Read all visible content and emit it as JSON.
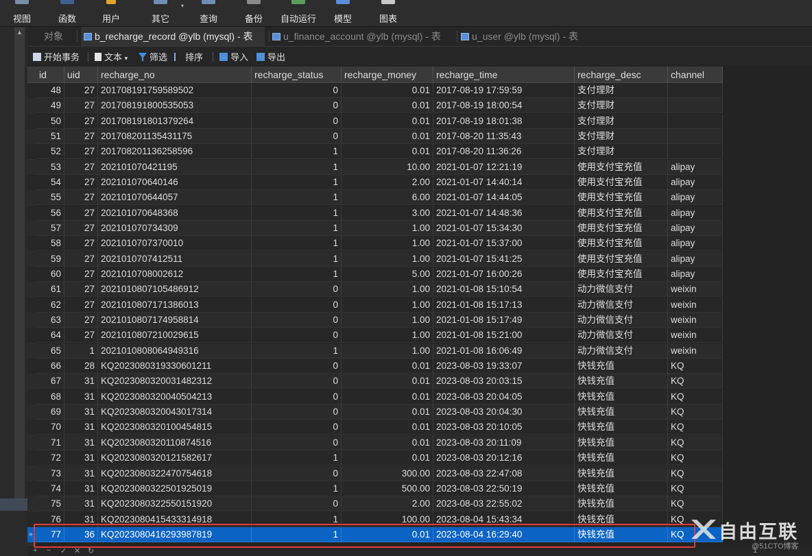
{
  "ribbon": {
    "items": [
      {
        "label": "视图",
        "icon": "view-icon"
      },
      {
        "label": "函数",
        "icon": "function-icon"
      },
      {
        "label": "用户",
        "icon": "user-icon"
      },
      {
        "label": "其它",
        "icon": "other-icon"
      },
      {
        "label": "查询",
        "icon": "query-icon"
      },
      {
        "label": "备份",
        "icon": "backup-icon"
      },
      {
        "label": "自动运行",
        "icon": "autorun-icon"
      },
      {
        "label": "模型",
        "icon": "model-icon"
      },
      {
        "label": "图表",
        "icon": "chart-icon"
      }
    ],
    "other_caret": "▾"
  },
  "tabs": [
    {
      "label": "对象",
      "active": false,
      "icon": ""
    },
    {
      "label": "b_recharge_record @ylb (mysql) - 表",
      "active": true,
      "icon": "table-icon"
    },
    {
      "label": "u_finance_account @ylb (mysql) - 表",
      "active": false,
      "icon": "table-icon"
    },
    {
      "label": "u_user @ylb (mysql) - 表",
      "active": false,
      "icon": "table-icon"
    }
  ],
  "toolbar": {
    "begin_transaction": "开始事务",
    "text": "文本",
    "text_caret": "▾",
    "filter": "筛选",
    "sort": "排序",
    "import": "导入",
    "export": "导出"
  },
  "grid": {
    "columns": [
      "id",
      "uid",
      "recharge_no",
      "recharge_status",
      "recharge_money",
      "recharge_time",
      "recharge_desc",
      "channel"
    ],
    "rows": [
      [
        "48",
        "27",
        "201708191759589502",
        "0",
        "0.01",
        "2017-08-19 17:59:59",
        "支付理财",
        ""
      ],
      [
        "49",
        "27",
        "201708191800535053",
        "0",
        "0.01",
        "2017-08-19 18:00:54",
        "支付理财",
        ""
      ],
      [
        "50",
        "27",
        "201708191801379264",
        "0",
        "0.01",
        "2017-08-19 18:01:38",
        "支付理财",
        ""
      ],
      [
        "51",
        "27",
        "201708201135431175",
        "0",
        "0.01",
        "2017-08-20 11:35:43",
        "支付理财",
        ""
      ],
      [
        "52",
        "27",
        "201708201136258596",
        "1",
        "0.01",
        "2017-08-20 11:36:26",
        "支付理财",
        ""
      ],
      [
        "53",
        "27",
        "202101070421195",
        "1",
        "10.00",
        "2021-01-07 12:21:19",
        "使用支付宝充值",
        "alipay"
      ],
      [
        "54",
        "27",
        "202101070640146",
        "1",
        "2.00",
        "2021-01-07 14:40:14",
        "使用支付宝充值",
        "alipay"
      ],
      [
        "55",
        "27",
        "202101070644057",
        "1",
        "6.00",
        "2021-01-07 14:44:05",
        "使用支付宝充值",
        "alipay"
      ],
      [
        "56",
        "27",
        "202101070648368",
        "1",
        "3.00",
        "2021-01-07 14:48:36",
        "使用支付宝充值",
        "alipay"
      ],
      [
        "57",
        "27",
        "202101070734309",
        "1",
        "1.00",
        "2021-01-07 15:34:30",
        "使用支付宝充值",
        "alipay"
      ],
      [
        "58",
        "27",
        "2021010707370010",
        "1",
        "1.00",
        "2021-01-07 15:37:00",
        "使用支付宝充值",
        "alipay"
      ],
      [
        "59",
        "27",
        "2021010707412511",
        "1",
        "1.00",
        "2021-01-07 15:41:25",
        "使用支付宝充值",
        "alipay"
      ],
      [
        "60",
        "27",
        "2021010708002612",
        "1",
        "5.00",
        "2021-01-07 16:00:26",
        "使用支付宝充值",
        "alipay"
      ],
      [
        "61",
        "27",
        "2021010807105486912",
        "0",
        "1.00",
        "2021-01-08 15:10:54",
        "动力微信支付",
        "weixin"
      ],
      [
        "62",
        "27",
        "2021010807171386013",
        "0",
        "1.00",
        "2021-01-08 15:17:13",
        "动力微信支付",
        "weixin"
      ],
      [
        "63",
        "27",
        "2021010807174958814",
        "0",
        "1.00",
        "2021-01-08 15:17:49",
        "动力微信支付",
        "weixin"
      ],
      [
        "64",
        "27",
        "2021010807210029615",
        "0",
        "1.00",
        "2021-01-08 15:21:00",
        "动力微信支付",
        "weixin"
      ],
      [
        "65",
        "1",
        "2021010808064949316",
        "1",
        "1.00",
        "2021-01-08 16:06:49",
        "动力微信支付",
        "weixin"
      ],
      [
        "66",
        "28",
        "KQ2023080319330601211",
        "0",
        "0.01",
        "2023-08-03 19:33:07",
        "快钱充值",
        "KQ"
      ],
      [
        "67",
        "31",
        "KQ2023080320031482312",
        "0",
        "0.01",
        "2023-08-03 20:03:15",
        "快钱充值",
        "KQ"
      ],
      [
        "68",
        "31",
        "KQ2023080320040504213",
        "0",
        "0.01",
        "2023-08-03 20:04:05",
        "快钱充值",
        "KQ"
      ],
      [
        "69",
        "31",
        "KQ2023080320043017314",
        "0",
        "0.01",
        "2023-08-03 20:04:30",
        "快钱充值",
        "KQ"
      ],
      [
        "70",
        "31",
        "KQ2023080320100454815",
        "0",
        "0.01",
        "2023-08-03 20:10:05",
        "快钱充值",
        "KQ"
      ],
      [
        "71",
        "31",
        "KQ2023080320110874516",
        "0",
        "0.01",
        "2023-08-03 20:11:09",
        "快钱充值",
        "KQ"
      ],
      [
        "72",
        "31",
        "KQ2023080320121582617",
        "1",
        "0.01",
        "2023-08-03 20:12:16",
        "快钱充值",
        "KQ"
      ],
      [
        "73",
        "31",
        "KQ2023080322470754618",
        "0",
        "300.00",
        "2023-08-03 22:47:08",
        "快钱充值",
        "KQ"
      ],
      [
        "74",
        "31",
        "KQ2023080322501925019",
        "1",
        "500.00",
        "2023-08-03 22:50:19",
        "快钱充值",
        "KQ"
      ],
      [
        "75",
        "31",
        "KQ2023080322550151920",
        "0",
        "2.00",
        "2023-08-03 22:55:02",
        "快钱充值",
        "KQ"
      ],
      [
        "76",
        "31",
        "KQ2023080415433314918",
        "1",
        "100.00",
        "2023-08-04 15:43:34",
        "快钱充值",
        "KQ"
      ],
      [
        "77",
        "36",
        "KQ2023080416293987819",
        "1",
        "0.01",
        "2023-08-04 16:29:40",
        "快钱充值",
        "KQ"
      ]
    ],
    "selected_row_index": 29,
    "selected_marker": "»"
  },
  "bottom_bar": {
    "add": "+",
    "remove": "−",
    "check": "✓",
    "cancel": "✕",
    "refresh": "↻",
    "page": "1"
  },
  "watermark": {
    "small": "@51CTO博客",
    "brand": "自由互联"
  },
  "colors": {
    "selection": "#0b63c4",
    "highlight_box": "#e23b3b",
    "table_icon": "#5b8fd6"
  }
}
